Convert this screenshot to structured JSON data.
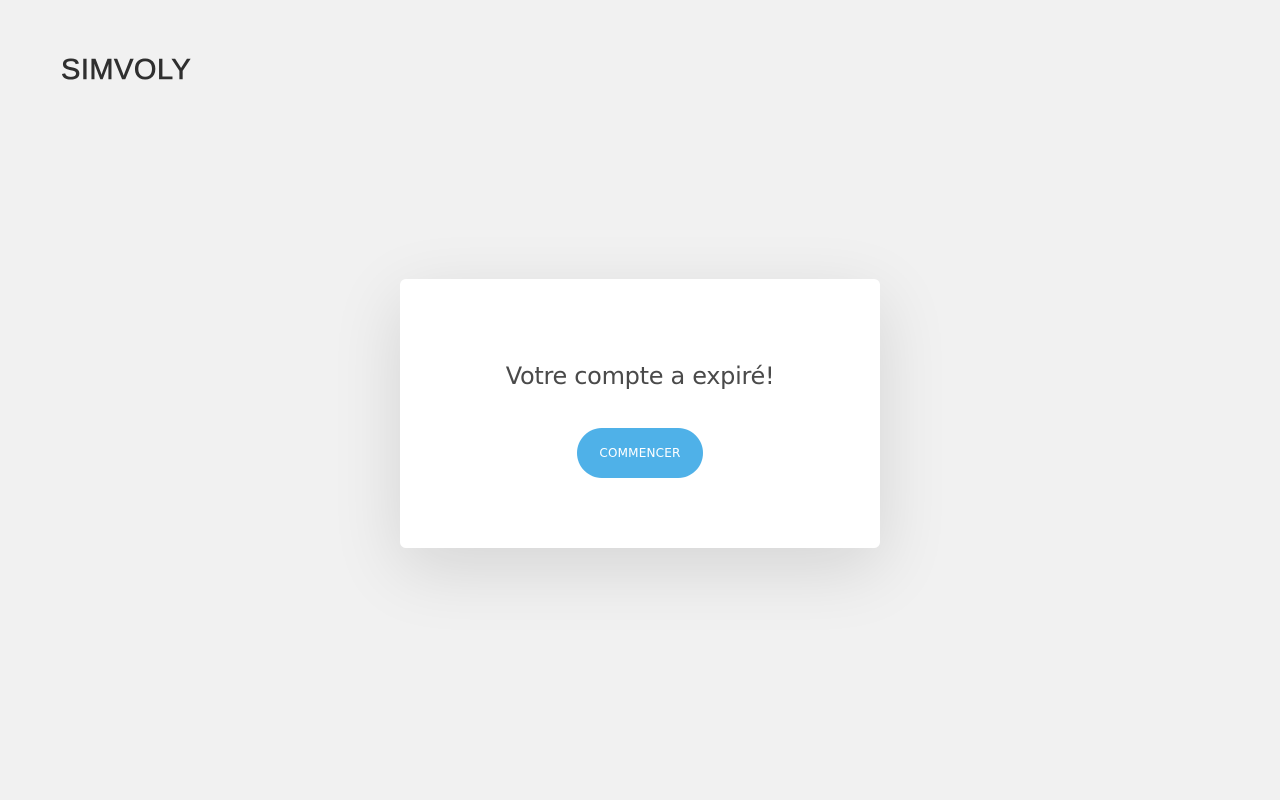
{
  "header": {
    "logo_text": "SIMVOLY"
  },
  "card": {
    "title": "Votre compte a expiré!",
    "button_label": "COMMENCER"
  },
  "colors": {
    "background": "#f1f1f1",
    "card": "#ffffff",
    "accent": "#4fb1e8",
    "text": "#4a4a4a",
    "logo": "#2f2f2f"
  }
}
